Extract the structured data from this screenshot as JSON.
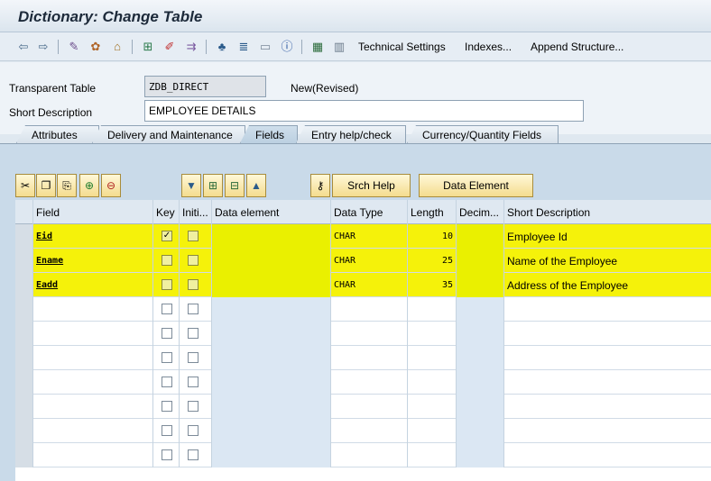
{
  "title": "Dictionary: Change Table",
  "toolbar": {
    "technical_settings": "Technical Settings",
    "indexes": "Indexes...",
    "append_structure": "Append Structure..."
  },
  "header": {
    "table_type_label": "Transparent Table",
    "table_name": "ZDB_DIRECT",
    "status": "New(Revised)",
    "short_desc_label": "Short Description",
    "short_desc_value": "EMPLOYEE DETAILS"
  },
  "tabs": [
    {
      "label": "Attributes"
    },
    {
      "label": "Delivery and Maintenance"
    },
    {
      "label": "Fields",
      "active": true
    },
    {
      "label": "Entry help/check"
    },
    {
      "label": "Currency/Quantity Fields"
    }
  ],
  "grid_toolbar": {
    "srch_help": "Srch Help",
    "data_element": "Data Element"
  },
  "columns": {
    "field": "Field",
    "key": "Key",
    "initial": "Initi...",
    "data_element": "Data element",
    "data_type": "Data Type",
    "length": "Length",
    "decimals": "Decim...",
    "short_description": "Short Description"
  },
  "rows": [
    {
      "field": "Eid",
      "key": true,
      "initial": false,
      "data_element": "",
      "data_type": "CHAR",
      "length": "10",
      "decimals": "",
      "short_description": "Employee Id"
    },
    {
      "field": "Ename",
      "key": false,
      "initial": false,
      "data_element": "",
      "data_type": "CHAR",
      "length": "25",
      "decimals": "",
      "short_description": "Name of the Employee"
    },
    {
      "field": "Eadd",
      "key": false,
      "initial": false,
      "data_element": "",
      "data_type": "CHAR",
      "length": "35",
      "decimals": "",
      "short_description": "Address of the Employee"
    }
  ],
  "empty_rows": 7,
  "icons": {
    "back": "arrow-left-icon",
    "forward": "arrow-right-icon",
    "display_change": "glasses-icon",
    "check": "check-objects-icon",
    "activate": "activate-icon",
    "where_used": "where-used-icon",
    "edit": "pencil-icon",
    "transport": "transport-icon",
    "hierarchy": "hierarchy-icon",
    "align": "align-icon",
    "display_object": "display-object-icon",
    "info": "info-icon",
    "structure": "structure-icon",
    "layout": "layout-icon"
  },
  "colors": {
    "highlight": "#f5f20a",
    "panel": "#c9dae9"
  }
}
